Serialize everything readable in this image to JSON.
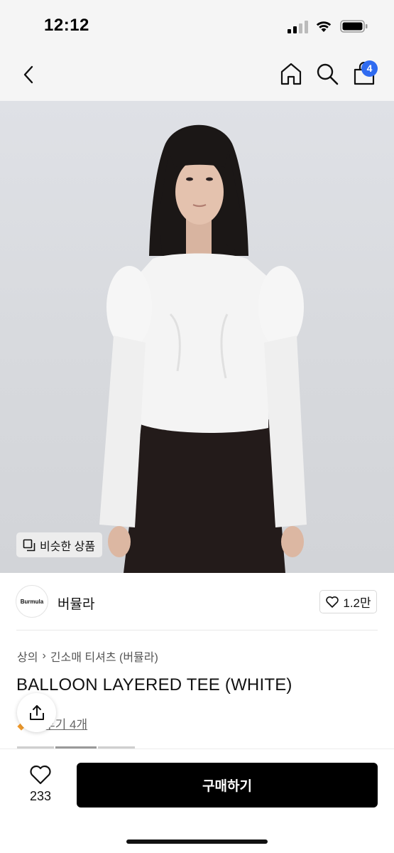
{
  "status": {
    "time": "12:12"
  },
  "header": {
    "cart_count": "4"
  },
  "hero": {
    "similar_label": "비슷한 상품"
  },
  "brand": {
    "logo_text": "Burmula",
    "name": "버뮬라",
    "likes": "1.2만"
  },
  "product": {
    "breadcrumb": [
      "상의",
      "긴소매 티셔츠 (버뮬라)"
    ],
    "title": "BALLOON LAYERED TEE (WHITE)",
    "review_text": "후기 4개"
  },
  "bottom": {
    "wish_count": "233",
    "buy_label": "구매하기"
  },
  "colors": {
    "badge": "#2f6bf0",
    "buy": "#000000",
    "star": "#f29b2b"
  }
}
